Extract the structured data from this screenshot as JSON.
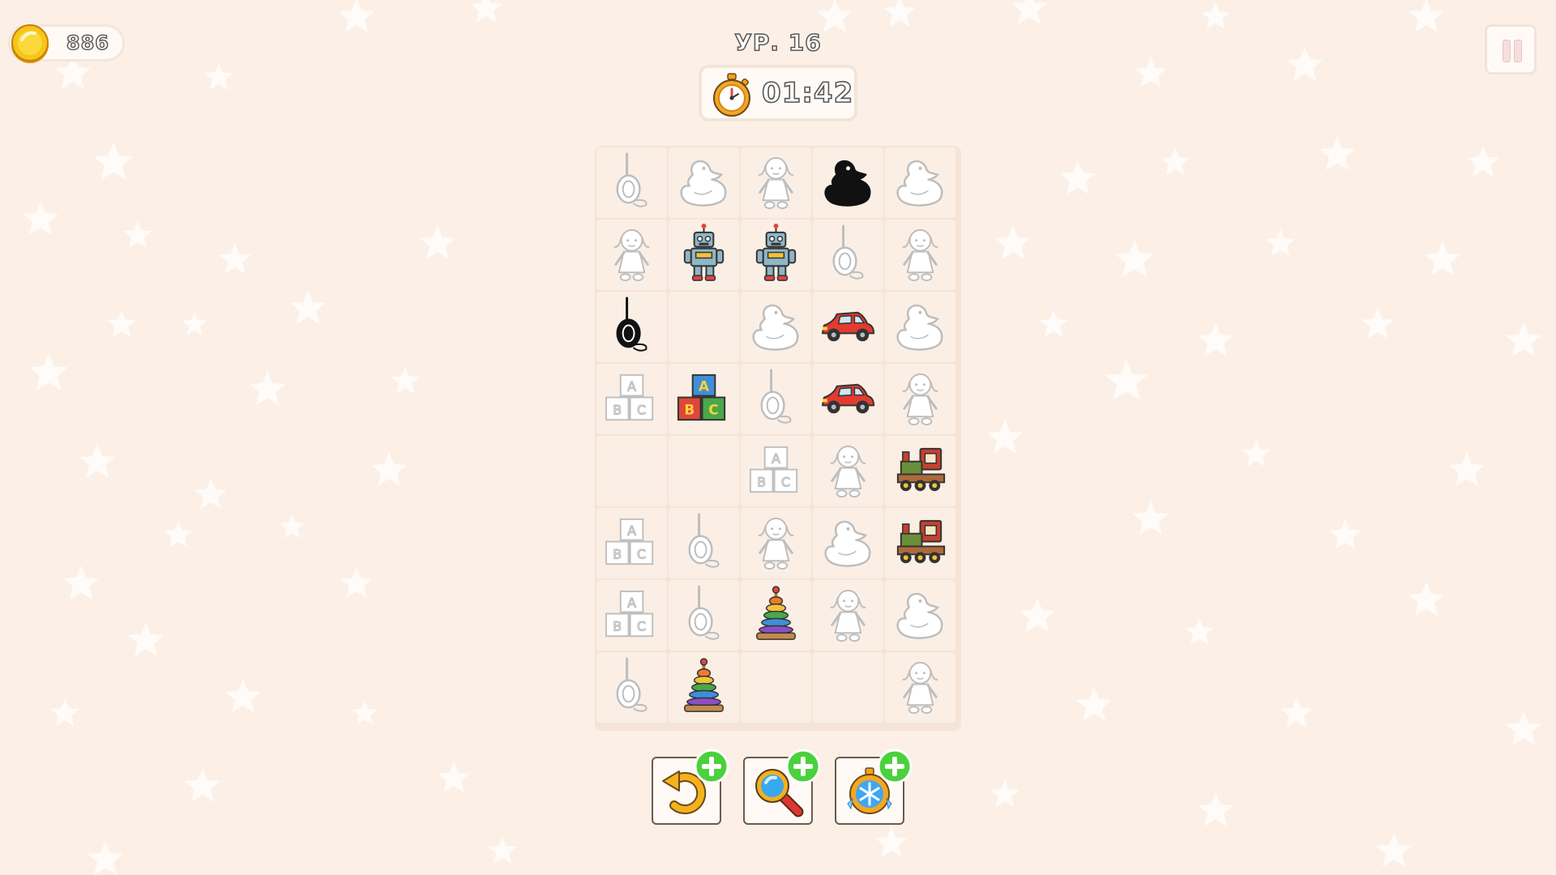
{
  "hud": {
    "coins": "886",
    "level": "УР. 16",
    "timer": "01:42"
  },
  "colors": {
    "background": "#fcf0e6",
    "board": "#f6e4d6",
    "cell": "#fbefe5",
    "plus_badge": "#4ad13c"
  },
  "grid": [
    [
      "yoyo-outline",
      "duck-outline",
      "doll-outline",
      "duck-silhouette",
      "duck-outline"
    ],
    [
      "doll-outline",
      "robot-color",
      "robot-color",
      "yoyo-outline",
      "doll-outline"
    ],
    [
      "yoyo-silhouette",
      "empty",
      "duck-outline",
      "car-color",
      "duck-outline"
    ],
    [
      "blocks-outline",
      "blocks-color",
      "yoyo-outline",
      "car-color",
      "doll-outline"
    ],
    [
      "empty",
      "empty",
      "blocks-outline",
      "doll-outline",
      "train-color"
    ],
    [
      "blocks-outline",
      "yoyo-outline",
      "doll-outline",
      "duck-outline",
      "train-color"
    ],
    [
      "blocks-outline",
      "yoyo-outline",
      "pyramid-color",
      "doll-outline",
      "duck-outline"
    ],
    [
      "yoyo-outline",
      "pyramid-color",
      "empty",
      "empty",
      "doll-outline"
    ]
  ],
  "boosters": [
    {
      "icon": "undo-icon"
    },
    {
      "icon": "magnifier-icon"
    },
    {
      "icon": "freeze-timer-icon"
    }
  ]
}
